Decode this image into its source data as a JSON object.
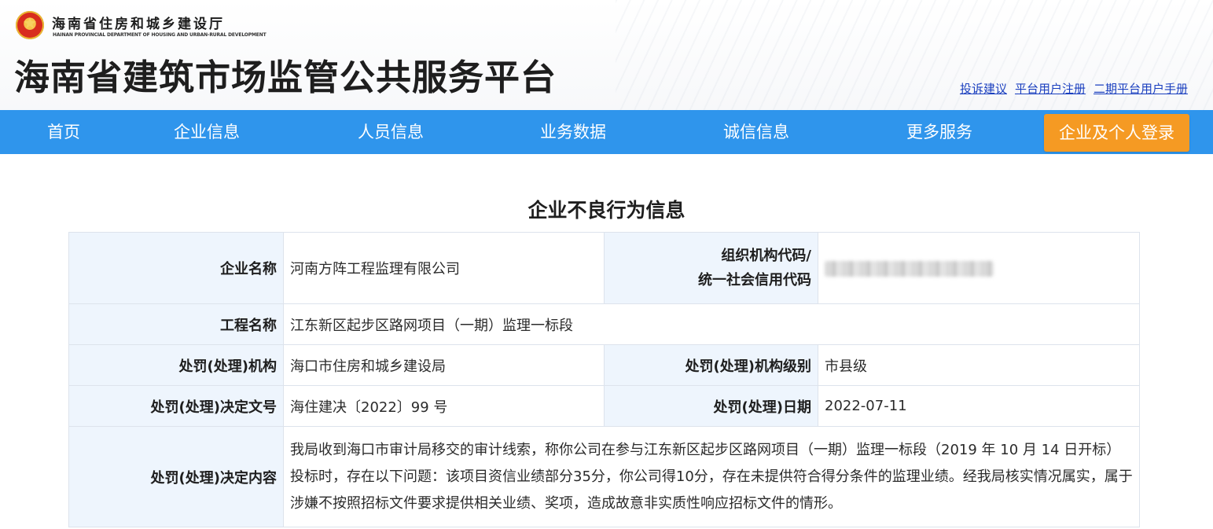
{
  "header": {
    "dept_cn": "海南省住房和城乡建设厅",
    "dept_en": "HAINAN PROVINCIAL DEPARTMENT OF HOUSING AND URBAN-RURAL DEVELOPMENT",
    "platform_title": "海南省建筑市场监管公共服务平台",
    "top_links": [
      "投诉建议",
      "平台用户注册",
      "二期平台用户手册"
    ]
  },
  "nav": {
    "items": [
      "首页",
      "企业信息",
      "人员信息",
      "业务数据",
      "诚信信息",
      "更多服务"
    ],
    "login": "企业及个人登录"
  },
  "page": {
    "heading": "企业不良行为信息"
  },
  "record": {
    "company_name_label": "企业名称",
    "company_name": "河南方阵工程监理有限公司",
    "org_code_label_1": "组织机构代码/",
    "org_code_label_2": "统一社会信用代码",
    "project_name_label": "工程名称",
    "project_name": "江东新区起步区路网项目（一期）监理一标段",
    "authority_label": "处罚(处理)机构",
    "authority": "海口市住房和城乡建设局",
    "authority_level_label": "处罚(处理)机构级别",
    "authority_level": "市县级",
    "doc_no_label": "处罚(处理)决定文号",
    "doc_no": "海住建决〔2022〕99 号",
    "date_label": "处罚(处理)日期",
    "date": "2022-07-11",
    "content_label": "处罚(处理)决定内容",
    "content": "我局收到海口市审计局移交的审计线索，称你公司在参与江东新区起步区路网项目（一期）监理一标段（2019 年 10 月 14 日开标）投标时，存在以下问题：该项目资信业绩部分35分，你公司得10分，存在未提供符合得分条件的监理业绩。经我局核实情况属实，属于涉嫌不按照招标文件要求提供相关业绩、奖项，造成故意非实质性响应招标文件的情形。"
  },
  "colors": {
    "nav_bg": "#2f95ec",
    "login_bg": "#f59a23",
    "label_bg": "#eef5fd",
    "link": "#1a3fbf"
  }
}
